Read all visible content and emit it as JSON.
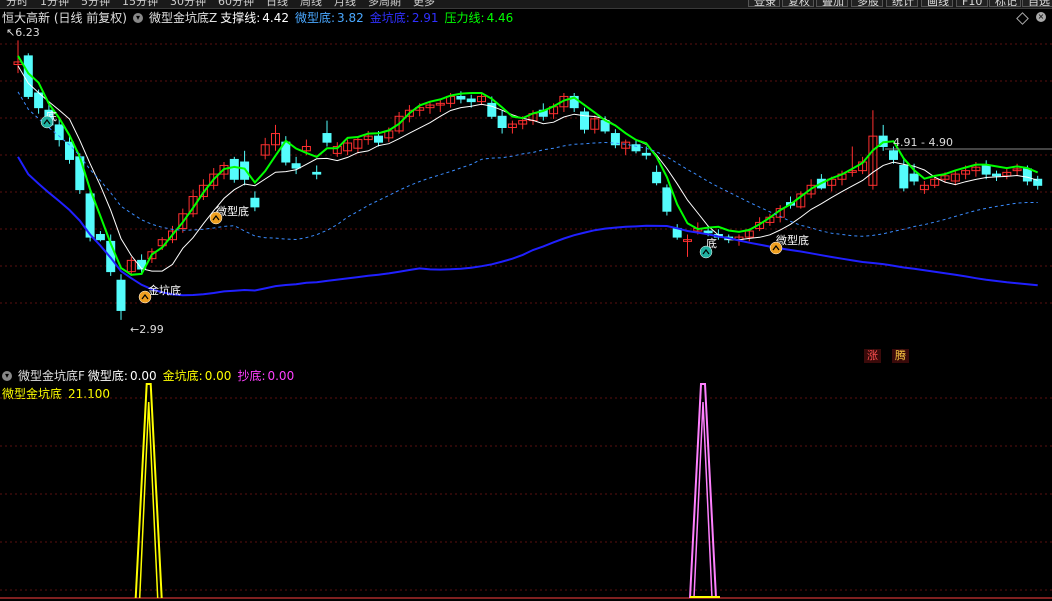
{
  "toolbar": {
    "periods": [
      "分时",
      "1分钟",
      "5分钟",
      "15分钟",
      "30分钟",
      "60分钟",
      "日线",
      "周线",
      "月线",
      "多周期",
      "更多"
    ],
    "right_buttons": [
      "登录",
      "复权",
      "叠加",
      "多股",
      "统计",
      "画线",
      "F10",
      "标记",
      "自选"
    ]
  },
  "main_legend": {
    "stock": "恒大高新 (日线 前复权)",
    "indicator": "微型金坑底Z",
    "support_label": "支撑线:",
    "support_value": "4.42",
    "micro_label": "微型底:",
    "micro_value": "3.82",
    "gold_label": "金坑底:",
    "gold_value": "2.91",
    "pressure_label": "压力线:",
    "pressure_value": "4.46"
  },
  "sub_legend": {
    "indicator": "微型金坑底F",
    "micro_label": "微型底:",
    "micro_value": "0.00",
    "gold_label": "金坑底:",
    "gold_value": "0.00",
    "chaodi_label": "抄底:",
    "chaodi_value": "0.00",
    "scale_label": "微型金坑底",
    "scale_value": "21.100"
  },
  "annotations": {
    "high": "6.23",
    "low": "2.99",
    "range": "4.91 - 4.90",
    "micro_bottom": "微型底",
    "gold_bottom": "金坑底",
    "bottom": "底",
    "badge_zhang": "涨",
    "badge_teng": "腾"
  },
  "colors": {
    "up": "#ff3030",
    "down": "#54fcfc",
    "support": "#ffffff",
    "pressure": "#00ff00",
    "ma_blue": "#2020ff",
    "ma_dashed": "#3a8cff",
    "signal_yellow": "#ffff00",
    "signal_pink": "#ff80ff"
  },
  "candles": [
    [
      5.95,
      6.23,
      5.85,
      5.98
    ],
    [
      6.05,
      6.08,
      5.55,
      5.58
    ],
    [
      5.62,
      5.66,
      5.38,
      5.45
    ],
    [
      5.42,
      5.48,
      5.22,
      5.25
    ],
    [
      5.25,
      5.32,
      5.0,
      5.08
    ],
    [
      5.05,
      5.12,
      4.8,
      4.85
    ],
    [
      4.88,
      4.92,
      4.45,
      4.5
    ],
    [
      4.45,
      4.5,
      3.9,
      3.95
    ],
    [
      3.98,
      4.02,
      3.9,
      3.92
    ],
    [
      3.9,
      3.98,
      3.5,
      3.55
    ],
    [
      3.45,
      3.52,
      2.99,
      3.1
    ],
    [
      3.55,
      3.72,
      3.5,
      3.68
    ],
    [
      3.68,
      3.75,
      3.52,
      3.58
    ],
    [
      3.7,
      3.82,
      3.65,
      3.78
    ],
    [
      3.85,
      3.95,
      3.8,
      3.92
    ],
    [
      3.92,
      4.08,
      3.88,
      4.02
    ],
    [
      4.05,
      4.28,
      4.0,
      4.22
    ],
    [
      4.22,
      4.5,
      4.18,
      4.42
    ],
    [
      4.42,
      4.62,
      4.38,
      4.55
    ],
    [
      4.55,
      4.75,
      4.5,
      4.68
    ],
    [
      4.68,
      4.82,
      4.62,
      4.78
    ],
    [
      4.85,
      4.88,
      4.58,
      4.62
    ],
    [
      4.82,
      4.95,
      4.55,
      4.62
    ],
    [
      4.4,
      4.48,
      4.25,
      4.3
    ],
    [
      4.9,
      5.1,
      4.85,
      5.02
    ],
    [
      5.02,
      5.25,
      4.95,
      5.15
    ],
    [
      5.05,
      5.12,
      4.78,
      4.82
    ],
    [
      4.8,
      4.88,
      4.68,
      4.75
    ],
    [
      4.95,
      5.08,
      4.9,
      5.0
    ],
    [
      4.7,
      4.78,
      4.62,
      4.68
    ],
    [
      5.15,
      5.3,
      5.0,
      5.05
    ],
    [
      4.92,
      5.05,
      4.88,
      5.0
    ],
    [
      4.95,
      5.08,
      4.9,
      5.04
    ],
    [
      4.98,
      5.12,
      4.92,
      5.08
    ],
    [
      5.08,
      5.18,
      5.02,
      5.12
    ],
    [
      5.12,
      5.18,
      5.0,
      5.05
    ],
    [
      5.1,
      5.22,
      5.05,
      5.18
    ],
    [
      5.18,
      5.4,
      5.15,
      5.35
    ],
    [
      5.35,
      5.48,
      5.28,
      5.42
    ],
    [
      5.42,
      5.5,
      5.35,
      5.45
    ],
    [
      5.45,
      5.52,
      5.38,
      5.48
    ],
    [
      5.48,
      5.55,
      5.4,
      5.5
    ],
    [
      5.5,
      5.62,
      5.45,
      5.58
    ],
    [
      5.58,
      5.64,
      5.5,
      5.55
    ],
    [
      5.55,
      5.6,
      5.45,
      5.52
    ],
    [
      5.52,
      5.62,
      5.48,
      5.58
    ],
    [
      5.5,
      5.58,
      5.32,
      5.35
    ],
    [
      5.35,
      5.42,
      5.15,
      5.22
    ],
    [
      5.22,
      5.3,
      5.15,
      5.26
    ],
    [
      5.26,
      5.35,
      5.2,
      5.3
    ],
    [
      5.3,
      5.42,
      5.25,
      5.38
    ],
    [
      5.42,
      5.5,
      5.3,
      5.35
    ],
    [
      5.38,
      5.5,
      5.32,
      5.46
    ],
    [
      5.46,
      5.62,
      5.4,
      5.58
    ],
    [
      5.58,
      5.62,
      5.4,
      5.45
    ],
    [
      5.4,
      5.45,
      5.15,
      5.2
    ],
    [
      5.2,
      5.36,
      5.15,
      5.32
    ],
    [
      5.3,
      5.35,
      5.15,
      5.18
    ],
    [
      5.15,
      5.2,
      4.98,
      5.02
    ],
    [
      4.98,
      5.08,
      4.9,
      5.05
    ],
    [
      5.02,
      5.08,
      4.92,
      4.95
    ],
    [
      4.92,
      5.0,
      4.85,
      4.9
    ],
    [
      4.7,
      4.78,
      4.55,
      4.58
    ],
    [
      4.52,
      4.56,
      4.2,
      4.25
    ],
    [
      4.05,
      4.1,
      3.92,
      3.95
    ],
    [
      3.9,
      3.98,
      3.72,
      3.92
    ],
    [
      4.02,
      4.12,
      3.98,
      4.05
    ],
    [
      4.02,
      4.08,
      3.96,
      4.0
    ],
    [
      3.98,
      4.04,
      3.92,
      3.95
    ],
    [
      3.95,
      3.98,
      3.88,
      3.92
    ],
    [
      3.92,
      3.98,
      3.85,
      3.95
    ],
    [
      3.95,
      4.05,
      3.9,
      4.02
    ],
    [
      4.05,
      4.18,
      4.02,
      4.12
    ],
    [
      4.12,
      4.22,
      4.08,
      4.18
    ],
    [
      4.18,
      4.32,
      4.12,
      4.28
    ],
    [
      4.35,
      4.42,
      4.28,
      4.32
    ],
    [
      4.3,
      4.48,
      4.28,
      4.45
    ],
    [
      4.45,
      4.62,
      4.4,
      4.55
    ],
    [
      4.62,
      4.68,
      4.5,
      4.52
    ],
    [
      4.55,
      4.65,
      4.48,
      4.62
    ],
    [
      4.62,
      4.72,
      4.55,
      4.68
    ],
    [
      4.7,
      5.0,
      4.65,
      4.72
    ],
    [
      4.72,
      4.88,
      4.68,
      4.82
    ],
    [
      4.55,
      5.42,
      4.5,
      5.12
    ],
    [
      5.12,
      5.25,
      4.95,
      5.0
    ],
    [
      4.95,
      5.0,
      4.8,
      4.85
    ],
    [
      4.78,
      4.85,
      4.48,
      4.52
    ],
    [
      4.68,
      4.8,
      4.55,
      4.6
    ],
    [
      4.5,
      4.6,
      4.45,
      4.55
    ],
    [
      4.55,
      4.65,
      4.52,
      4.62
    ],
    [
      4.62,
      4.7,
      4.58,
      4.66
    ],
    [
      4.6,
      4.72,
      4.55,
      4.68
    ],
    [
      4.68,
      4.78,
      4.62,
      4.72
    ],
    [
      4.72,
      4.82,
      4.65,
      4.76
    ],
    [
      4.78,
      4.84,
      4.62,
      4.68
    ],
    [
      4.68,
      4.72,
      4.6,
      4.66
    ],
    [
      4.66,
      4.74,
      4.62,
      4.7
    ],
    [
      4.72,
      4.8,
      4.66,
      4.74
    ],
    [
      4.74,
      4.78,
      4.55,
      4.6
    ],
    [
      4.62,
      4.66,
      4.5,
      4.55
    ]
  ],
  "signals": {
    "gold_pulse_index": 9,
    "micro_pulse_index": 50
  }
}
